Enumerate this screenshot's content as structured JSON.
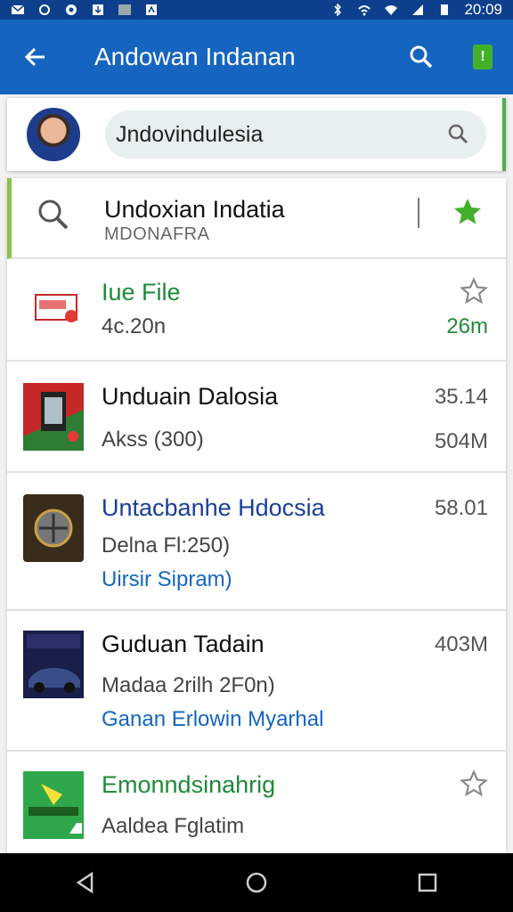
{
  "status": {
    "time": "20:09"
  },
  "app_bar": {
    "title": "Andowan Indanan"
  },
  "profile": {
    "search_value": "Jndovindulesia"
  },
  "list": {
    "header_item": {
      "title": "Undoxian Indatia",
      "subtitle": "MDONAFRA"
    },
    "items": [
      {
        "title": "Iue File",
        "sub": "4c.20n",
        "right_bottom": "26m"
      },
      {
        "title": "Unduain Dalosia",
        "sub": "Akss (300)",
        "right_top": "35.14",
        "right_bottom": "504M"
      },
      {
        "title": "Untacbanhe Hdocsia",
        "sub": "Delna Fl:250)",
        "sub2": "Uirsir Sipram)",
        "right_top": "58.01"
      },
      {
        "title": "Guduan Tadain",
        "sub": "Madaa 2rilh 2F0n)",
        "sub2": "Ganan Erlowin Myarhal",
        "right_top": "403M"
      },
      {
        "title": "Emonndsinahrig",
        "sub": "Aaldea Fglatim"
      }
    ]
  },
  "icons": {
    "back": "arrow-back-icon",
    "search": "search-icon",
    "battery": "battery-icon",
    "star_filled": "star-filled-icon",
    "star_outline": "star-outline-icon",
    "nav_back": "triangle-back-icon",
    "nav_home": "circle-home-icon",
    "nav_recent": "square-recents-icon"
  },
  "colors": {
    "app_bar": "#1565c0",
    "status_bar": "#0d3f8c",
    "accent_green": "#43b02a",
    "link_blue": "#1565c0"
  }
}
